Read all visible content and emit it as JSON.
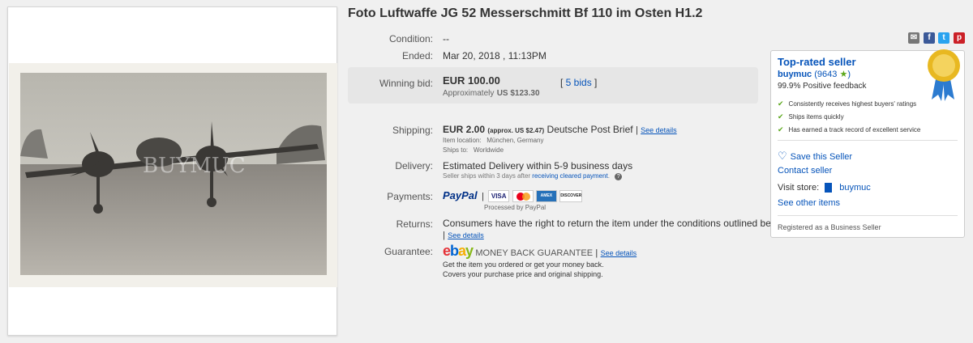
{
  "title": "Foto Luftwaffe JG 52 Messerschmitt Bf 110 im Osten H1.2",
  "photo": {
    "watermark": "BUYMUC",
    "alt": "Black and white photo of a Messerschmitt Bf 110 aircraft"
  },
  "social_icons": [
    "envelope-icon",
    "facebook-icon",
    "twitter-icon",
    "pinterest-icon"
  ],
  "details": {
    "condition": {
      "label": "Condition:",
      "value": "--"
    },
    "ended": {
      "label": "Ended:",
      "value": "Mar 20, 2018 , 11:13PM"
    },
    "winning_bid": {
      "label": "Winning bid:",
      "amount": "EUR 100.00",
      "approx_prefix": "Approximately",
      "approx_value": "US $123.30",
      "bids": "5 bids"
    },
    "shipping": {
      "label": "Shipping:",
      "amount": "EUR 2.00",
      "approx": "(approx. US $2.47)",
      "service": "Deutsche Post Brief",
      "see_details": "See details",
      "item_location_label": "Item location:",
      "item_location": "München, Germany",
      "ships_to_label": "Ships to:",
      "ships_to": "Worldwide"
    },
    "delivery": {
      "label": "Delivery:",
      "value": "Estimated Delivery within 5-9 business days",
      "note_prefix": "Seller ships within 3 days after",
      "note_link": "receiving cleared payment",
      "note_suffix": "."
    },
    "payments": {
      "label": "Payments:",
      "paypal": "PayPal",
      "cards": [
        "VISA",
        "MC",
        "AMEX",
        "DISCOVER"
      ],
      "processed_by": "Processed by PayPal"
    },
    "returns": {
      "label": "Returns:",
      "value": "Consumers have the right to return the item under the conditions outlined below",
      "see_details": "See details"
    },
    "guarantee": {
      "label": "Guarantee:",
      "logo": "ebay",
      "logo_text": "MONEY BACK GUARANTEE",
      "see_details": "See details",
      "line1": "Get the item you ordered or get your money back.",
      "line2": "Covers your purchase price and original shipping."
    }
  },
  "seller": {
    "heading": "Top-rated seller",
    "name": "buymuc",
    "score": "(9643",
    "score_close": ")",
    "feedback": "99.9% Positive feedback",
    "bullets": [
      "Consistently receives highest buyers' ratings",
      "Ships items quickly",
      "Has earned a track record of excellent service"
    ],
    "save_seller": "Save this Seller",
    "contact": "Contact seller",
    "visit_store_label": "Visit store:",
    "store_name": "buymuc",
    "other_items": "See other items",
    "registered": "Registered as a Business Seller"
  },
  "colors": {
    "link": "#0654ba",
    "check": "#5ba71b",
    "star": "#5ba71b",
    "bid_box": "#e6e6e6"
  }
}
